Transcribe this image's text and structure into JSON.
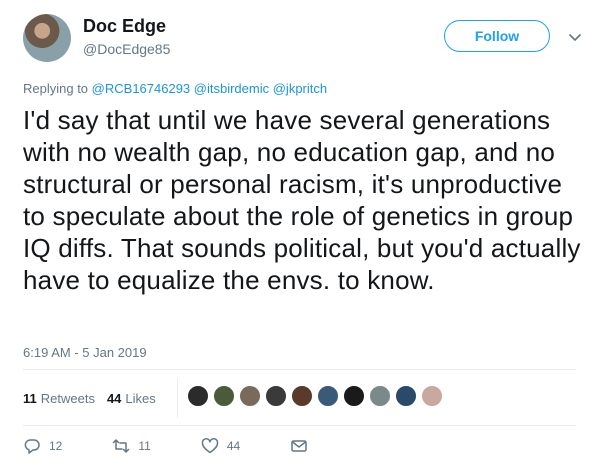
{
  "author": {
    "name": "Doc Edge",
    "handle": "@DocEdge85"
  },
  "follow_label": "Follow",
  "replying": {
    "prefix": "Replying to",
    "mentions": [
      "@RCB16746293",
      "@itsbirdemic",
      "@jkpritch"
    ]
  },
  "tweet_text": "I'd say that until we have several generations with no wealth gap, no education gap, and no structural or personal racism, it's unproductive to speculate about the role of genetics in group IQ diffs. That sounds political, but you'd actually have to equalize the envs. to know.",
  "timestamp": "6:19 AM - 5 Jan 2019",
  "stats": {
    "retweets_count": "11",
    "retweets_label": "Retweets",
    "likes_count": "44",
    "likes_label": "Likes"
  },
  "liker_colors": [
    "#2b2b2b",
    "#4a5a3a",
    "#7a6a5a",
    "#3a3a3a",
    "#5a3a2a",
    "#3a5a7a",
    "#1a1a1a",
    "#7a8a8a",
    "#2a4a6a",
    "#c9a8a0"
  ],
  "actions": {
    "reply_count": "12",
    "retweet_count": "11",
    "like_count": "44"
  },
  "colors": {
    "accent": "#1da1f2",
    "secondary_text": "#657786",
    "mention": "#1b95e0"
  }
}
